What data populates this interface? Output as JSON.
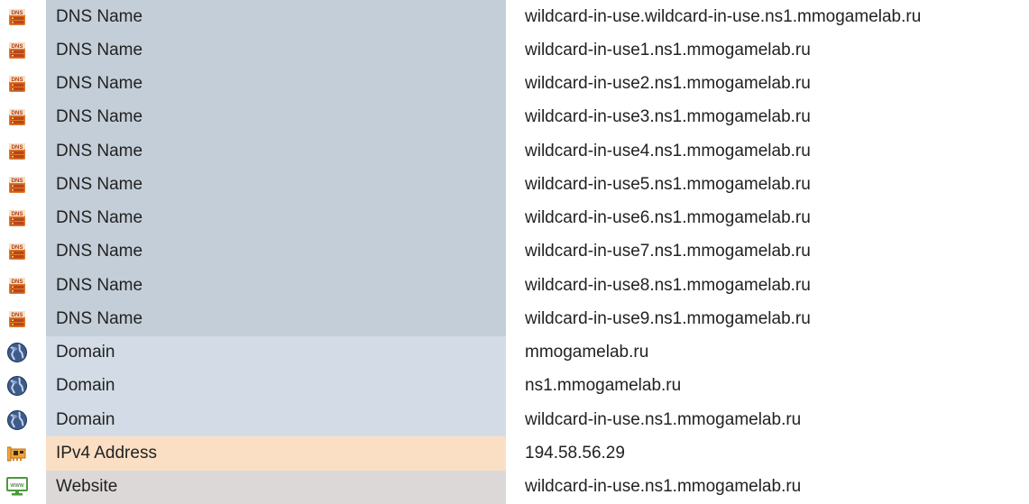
{
  "entity_colors": {
    "dns_name": "#c4ced8",
    "domain": "#d3dce6",
    "ipv4_address": "#fbdfc4",
    "website": "#ddd8d8"
  },
  "rows": [
    {
      "icon": "dns-server-icon",
      "type": "DNS Name",
      "kind": "dns_name",
      "value": "wildcard-in-use.wildcard-in-use.ns1.mmogamelab.ru"
    },
    {
      "icon": "dns-server-icon",
      "type": "DNS Name",
      "kind": "dns_name",
      "value": "wildcard-in-use1.ns1.mmogamelab.ru"
    },
    {
      "icon": "dns-server-icon",
      "type": "DNS Name",
      "kind": "dns_name",
      "value": "wildcard-in-use2.ns1.mmogamelab.ru"
    },
    {
      "icon": "dns-server-icon",
      "type": "DNS Name",
      "kind": "dns_name",
      "value": "wildcard-in-use3.ns1.mmogamelab.ru"
    },
    {
      "icon": "dns-server-icon",
      "type": "DNS Name",
      "kind": "dns_name",
      "value": "wildcard-in-use4.ns1.mmogamelab.ru"
    },
    {
      "icon": "dns-server-icon",
      "type": "DNS Name",
      "kind": "dns_name",
      "value": "wildcard-in-use5.ns1.mmogamelab.ru"
    },
    {
      "icon": "dns-server-icon",
      "type": "DNS Name",
      "kind": "dns_name",
      "value": "wildcard-in-use6.ns1.mmogamelab.ru"
    },
    {
      "icon": "dns-server-icon",
      "type": "DNS Name",
      "kind": "dns_name",
      "value": "wildcard-in-use7.ns1.mmogamelab.ru"
    },
    {
      "icon": "dns-server-icon",
      "type": "DNS Name",
      "kind": "dns_name",
      "value": "wildcard-in-use8.ns1.mmogamelab.ru"
    },
    {
      "icon": "dns-server-icon",
      "type": "DNS Name",
      "kind": "dns_name",
      "value": "wildcard-in-use9.ns1.mmogamelab.ru"
    },
    {
      "icon": "globe-icon",
      "type": "Domain",
      "kind": "domain",
      "value": "mmogamelab.ru"
    },
    {
      "icon": "globe-icon",
      "type": "Domain",
      "kind": "domain",
      "value": "ns1.mmogamelab.ru"
    },
    {
      "icon": "globe-icon",
      "type": "Domain",
      "kind": "domain",
      "value": "wildcard-in-use.ns1.mmogamelab.ru"
    },
    {
      "icon": "network-card-icon",
      "type": "IPv4 Address",
      "kind": "ipv4_address",
      "value": "194.58.56.29"
    },
    {
      "icon": "website-monitor-icon",
      "type": "Website",
      "kind": "website",
      "value": "wildcard-in-use.ns1.mmogamelab.ru"
    }
  ],
  "icon_text": {
    "dns": "DNS",
    "www": "www"
  }
}
